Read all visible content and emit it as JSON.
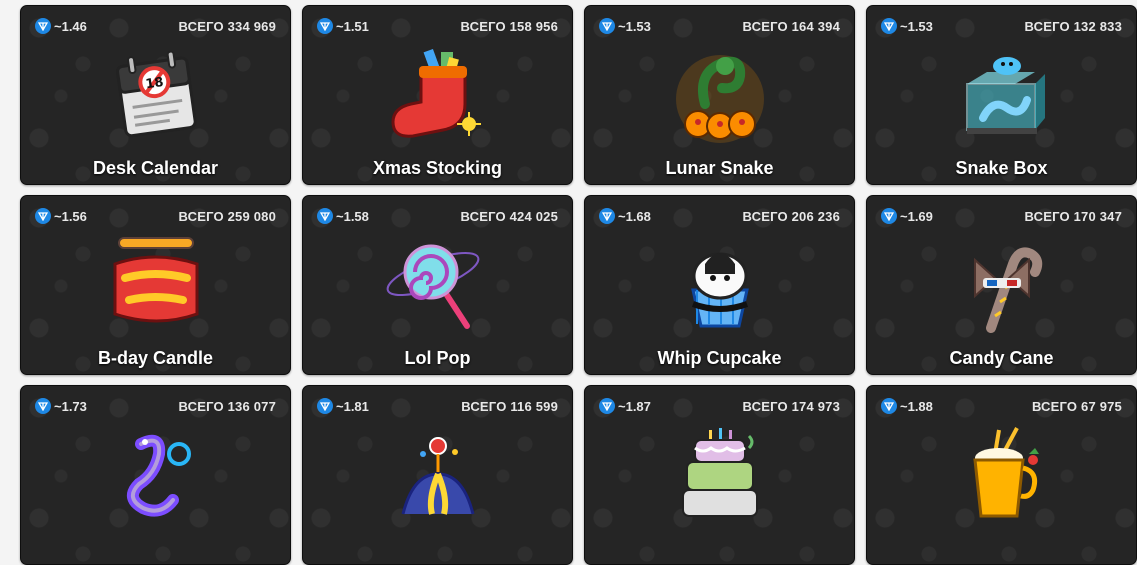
{
  "gifts": [
    {
      "price": "~1.46",
      "total": "ВСЕГО 334 969",
      "name": "Desk Calendar",
      "icon": "desk-calendar"
    },
    {
      "price": "~1.51",
      "total": "ВСЕГО 158 956",
      "name": "Xmas Stocking",
      "icon": "xmas-stocking"
    },
    {
      "price": "~1.53",
      "total": "ВСЕГО 164 394",
      "name": "Lunar Snake",
      "icon": "lunar-snake"
    },
    {
      "price": "~1.53",
      "total": "ВСЕГО 132 833",
      "name": "Snake Box",
      "icon": "snake-box"
    },
    {
      "price": "~1.56",
      "total": "ВСЕГО 259 080",
      "name": "B-day Candle",
      "icon": "bday-candle"
    },
    {
      "price": "~1.58",
      "total": "ВСЕГО 424 025",
      "name": "Lol Pop",
      "icon": "lol-pop"
    },
    {
      "price": "~1.68",
      "total": "ВСЕГО 206 236",
      "name": "Whip Cupcake",
      "icon": "whip-cupcake"
    },
    {
      "price": "~1.69",
      "total": "ВСЕГО 170 347",
      "name": "Candy Cane",
      "icon": "candy-cane"
    },
    {
      "price": "~1.73",
      "total": "ВСЕГО 136 077",
      "name": "",
      "icon": "neon-snake"
    },
    {
      "price": "~1.81",
      "total": "ВСЕГО 116 599",
      "name": "",
      "icon": "jester-hat"
    },
    {
      "price": "~1.87",
      "total": "ВСЕГО 174 973",
      "name": "",
      "icon": "birthday-cake"
    },
    {
      "price": "~1.88",
      "total": "ВСЕГО 67 975",
      "name": "",
      "icon": "golden-drink"
    }
  ],
  "colors": {
    "card_bg": "#252525",
    "ton_blue": "#1e88e5",
    "page_bg": "#f4f4f4"
  },
  "currency_icon": "ton-diamond-icon"
}
